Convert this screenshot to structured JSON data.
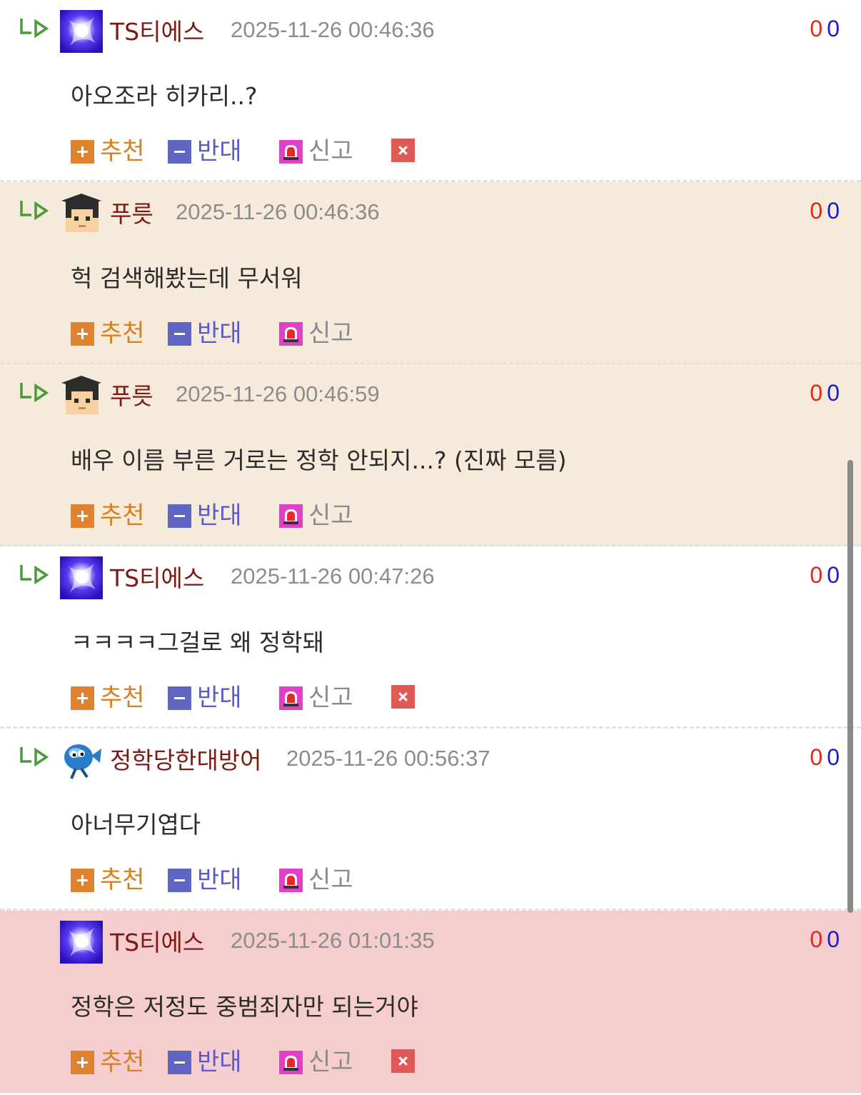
{
  "colors": {
    "beige_row": "#f6eadb",
    "pink_row": "#f5cdcf",
    "white_row": "#ffffff"
  },
  "labels": {
    "recommend": "추천",
    "oppose": "반대",
    "report": "신고"
  },
  "comments": [
    {
      "nick": "TS티에스",
      "date": "2025-11-26 00:46:36",
      "up": "0",
      "down": "0",
      "text": "아오조라 히카리..?",
      "avatar": "sparkle-avatar",
      "reply": true,
      "deletable": true,
      "bg": "white"
    },
    {
      "nick": "푸릇",
      "date": "2025-11-26 00:46:36",
      "up": "0",
      "down": "0",
      "text": "헉 검색해봤는데 무서워",
      "avatar": "graduate-avatar",
      "reply": true,
      "deletable": false,
      "bg": "beige"
    },
    {
      "nick": "푸릇",
      "date": "2025-11-26 00:46:59",
      "up": "0",
      "down": "0",
      "text": "배우 이름 부른 거로는 정학 안되지...? (진짜 모름)",
      "avatar": "graduate-avatar",
      "reply": true,
      "deletable": false,
      "bg": "beige"
    },
    {
      "nick": "TS티에스",
      "date": "2025-11-26 00:47:26",
      "up": "0",
      "down": "0",
      "text": "ㅋㅋㅋㅋ그걸로 왜 정학돼",
      "avatar": "sparkle-avatar",
      "reply": true,
      "deletable": true,
      "bg": "white"
    },
    {
      "nick": "정학당한대방어",
      "date": "2025-11-26 00:56:37",
      "up": "0",
      "down": "0",
      "text": "아너무기엽다",
      "avatar": "fish-avatar",
      "reply": true,
      "deletable": false,
      "bg": "white"
    },
    {
      "nick": "TS티에스",
      "date": "2025-11-26 01:01:35",
      "up": "0",
      "down": "0",
      "text": "정학은 저정도 중범죄자만 되는거야",
      "avatar": "sparkle-avatar",
      "reply": false,
      "deletable": true,
      "bg": "pink"
    }
  ]
}
